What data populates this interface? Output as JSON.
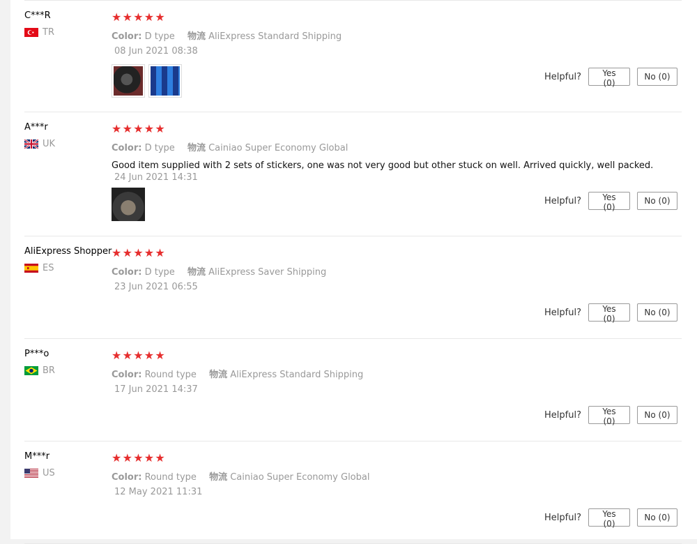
{
  "helpful_label": "Helpful?",
  "reviews": [
    {
      "user": "C***R",
      "country": "TR",
      "rating": 5,
      "color_label": "Color:",
      "color": "D type",
      "ship_label": "物流",
      "shipping": "AliExpress Standard Shipping",
      "text": "",
      "date": "08 Jun 2021 08:38",
      "photos": [
        "steering-wheel-photo",
        "blue-stickers-photo"
      ],
      "yes": "Yes (0)",
      "no": "No (0)"
    },
    {
      "user": "A***r",
      "country": "UK",
      "rating": 5,
      "color_label": "Color:",
      "color": "D type",
      "ship_label": "物流",
      "shipping": "Cainiao Super Economy Global",
      "text": "Good item supplied with 2 sets of stickers, one was not very good but other stuck on well. Arrived quickly, well packed.",
      "date": "24 Jun 2021 14:31",
      "photos": [
        "dashboard-photo"
      ],
      "yes": "Yes (0)",
      "no": "No (0)"
    },
    {
      "user": "AliExpress Shopper",
      "country": "ES",
      "rating": 5,
      "color_label": "Color:",
      "color": "D type",
      "ship_label": "物流",
      "shipping": "AliExpress Saver Shipping",
      "text": "",
      "date": "23 Jun 2021 06:55",
      "photos": [],
      "yes": "Yes (0)",
      "no": "No (0)"
    },
    {
      "user": "P***o",
      "country": "BR",
      "rating": 5,
      "color_label": "Color:",
      "color": "Round type",
      "ship_label": "物流",
      "shipping": "AliExpress Standard Shipping",
      "text": "",
      "date": "17 Jun 2021 14:37",
      "photos": [],
      "yes": "Yes (0)",
      "no": "No (0)"
    },
    {
      "user": "M***r",
      "country": "US",
      "rating": 5,
      "color_label": "Color:",
      "color": "Round type",
      "ship_label": "物流",
      "shipping": "Cainiao Super Economy Global",
      "text": "",
      "date": "12 May 2021 11:31",
      "photos": [],
      "yes": "Yes (0)",
      "no": "No (0)"
    }
  ],
  "colors": {
    "star": "#e62e2e",
    "muted": "#999999",
    "divider": "#e8e8e8"
  }
}
